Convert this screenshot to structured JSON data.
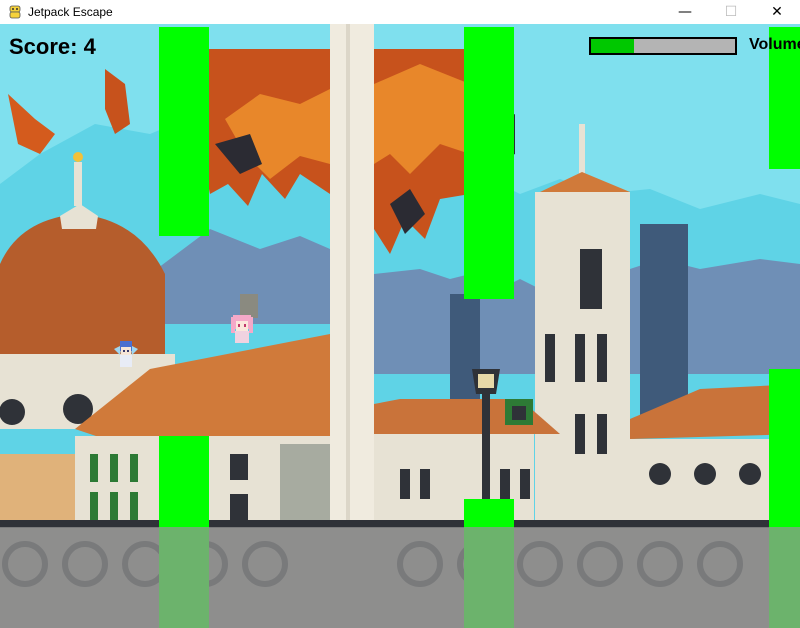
{
  "window": {
    "title": "Jetpack Escape",
    "minimize_glyph": "—",
    "maximize_glyph": "☐",
    "close_glyph": "✕"
  },
  "hud": {
    "score_text": "Score: 4",
    "volume_label": "Volume",
    "volume_level": 0.3
  },
  "sprites": {
    "player": "winged-character-sprite",
    "enemy": "pink-character-sprite"
  },
  "colors": {
    "pipe": "#00ff00",
    "volume_fill": "#00c800",
    "volume_track": "#b4b4b4",
    "ground_overlay": "#969696"
  }
}
